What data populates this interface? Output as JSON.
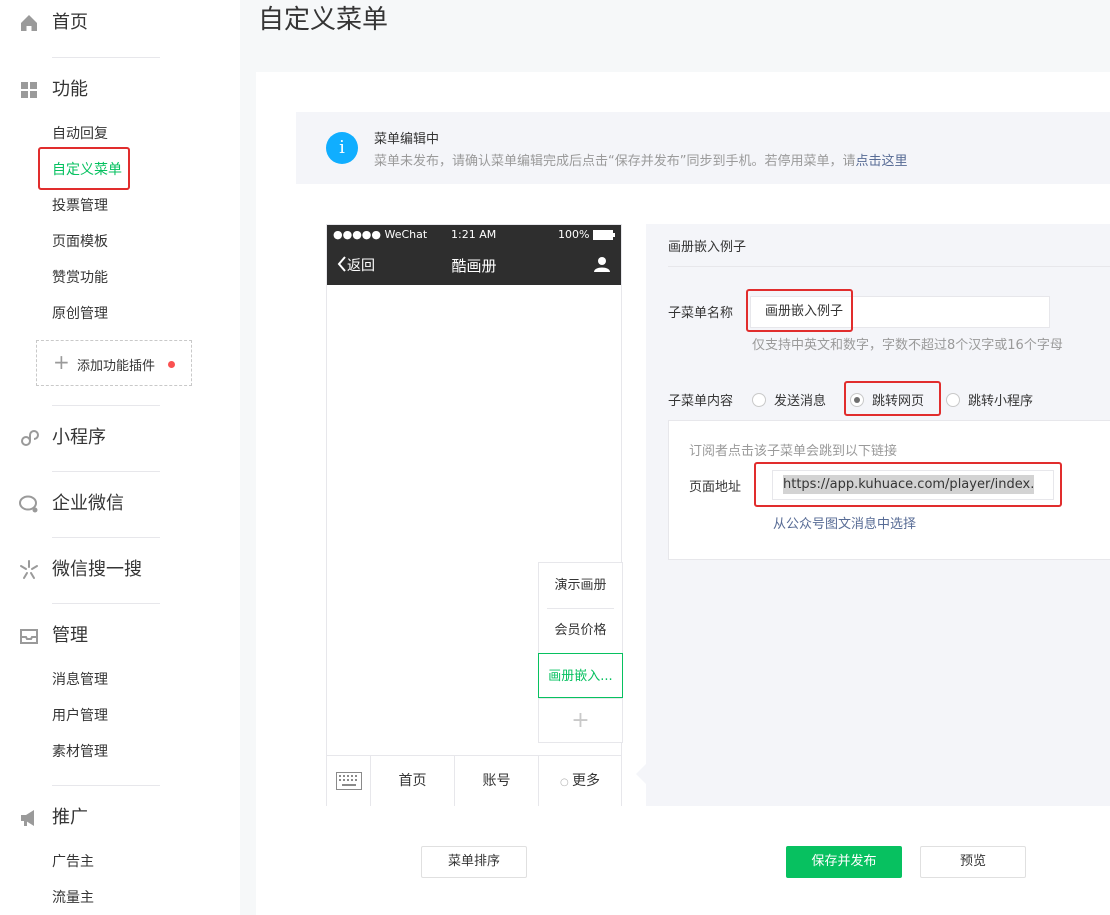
{
  "sidebar": {
    "home": "首页",
    "functions": {
      "label": "功能",
      "items": [
        "自动回复",
        "自定义菜单",
        "投票管理",
        "页面模板",
        "赞赏功能",
        "原创管理"
      ],
      "add_plugin": "添加功能插件"
    },
    "miniprogram": "小程序",
    "wework": "企业微信",
    "search": "微信搜一搜",
    "manage": {
      "label": "管理",
      "items": [
        "消息管理",
        "用户管理",
        "素材管理"
      ]
    },
    "promote": {
      "label": "推广",
      "items": [
        "广告主",
        "流量主"
      ]
    }
  },
  "page_title": "自定义菜单",
  "notice": {
    "title": "菜单编辑中",
    "desc": "菜单未发布，请确认菜单编辑完成后点击“保存并发布”同步到手机。若停用菜单，请",
    "link": "点击这里"
  },
  "phone": {
    "carrier": "●●●●● WeChat",
    "time": "1:21 AM",
    "battery": "100%",
    "back": "返回",
    "title": "酷画册",
    "submenu": [
      "演示画册",
      "会员价格",
      "画册嵌入..."
    ],
    "menu": [
      "首页",
      "账号",
      "更多"
    ]
  },
  "editor": {
    "header": "画册嵌入例子",
    "name_label": "子菜单名称",
    "name_value": "画册嵌入例子",
    "name_hint": "仅支持中英文和数字，字数不超过8个汉字或16个字母",
    "content_label": "子菜单内容",
    "options": [
      "发送消息",
      "跳转网页",
      "跳转小程序"
    ],
    "selected": "跳转网页",
    "sub_hint": "订阅者点击该子菜单会跳到以下链接",
    "url_label": "页面地址",
    "url_value": "https://app.kuhuace.com/player/index.",
    "pick_link": "从公众号图文消息中选择"
  },
  "buttons": {
    "sort": "菜单排序",
    "save": "保存并发布",
    "preview": "预览"
  },
  "colors": {
    "accent": "#07c160",
    "highlight": "#e12d2d",
    "link": "#576b95",
    "info": "#10aeff"
  }
}
